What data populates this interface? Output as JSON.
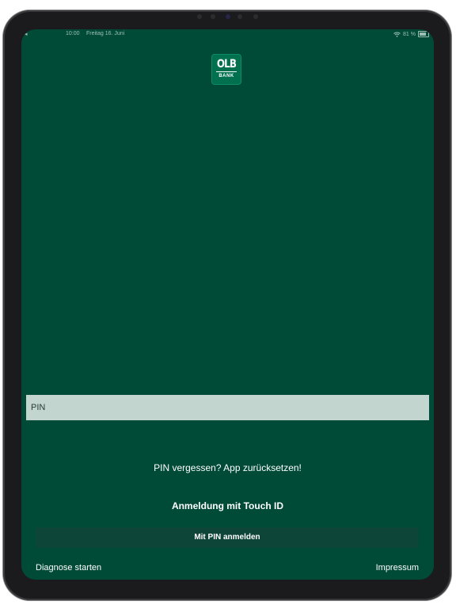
{
  "status_bar": {
    "back_glyph": "◂",
    "time": "10:00",
    "date": "Freitag 16. Juni",
    "wifi_icon": "wifi-icon",
    "battery_percent": "81 %"
  },
  "logo": {
    "main": "OLB",
    "sub": "BANK"
  },
  "login": {
    "pin_placeholder": "PIN",
    "forgot_text": "PIN vergessen? App zurücksetzen!",
    "touchid_label": "Anmeldung mit Touch ID",
    "pin_button_label": "Mit PIN anmelden"
  },
  "footer": {
    "diagnose_label": "Diagnose starten",
    "impressum_label": "Impressum"
  },
  "colors": {
    "background": "#004b37",
    "field": "#c3d5cf",
    "button": "#0d4538",
    "logo": "#00704f"
  }
}
